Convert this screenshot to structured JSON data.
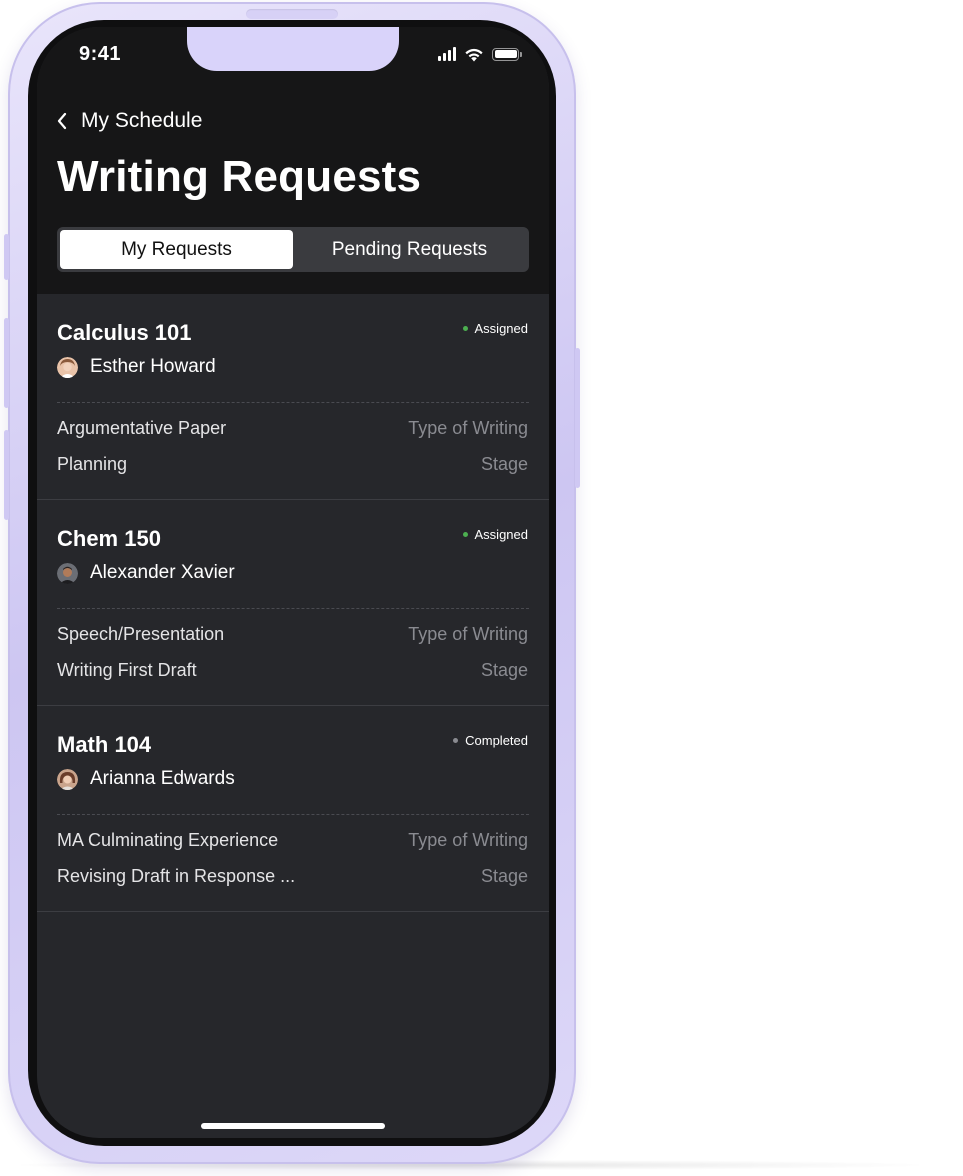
{
  "status_bar": {
    "time": "9:41"
  },
  "header": {
    "back_label": "My Schedule",
    "title": "Writing Requests"
  },
  "tabs": [
    {
      "label": "My Requests",
      "active": true
    },
    {
      "label": "Pending Requests",
      "active": false
    }
  ],
  "requests": [
    {
      "course": "Calculus 101",
      "status": "Assigned",
      "status_color": "#4caf50",
      "person": "Esther Howard",
      "type_value": "Argumentative Paper",
      "type_label": "Type of Writing",
      "stage_value": "Planning",
      "stage_label": "Stage"
    },
    {
      "course": "Chem 150",
      "status": "Assigned",
      "status_color": "#4caf50",
      "person": "Alexander Xavier",
      "type_value": "Speech/Presentation",
      "type_label": "Type of Writing",
      "stage_value": "Writing First Draft",
      "stage_label": "Stage"
    },
    {
      "course": "Math 104",
      "status": "Completed",
      "status_color": "#8a8b91",
      "person": "Arianna Edwards",
      "type_value": "MA Culminating Experience",
      "type_label": "Type of Writing",
      "stage_value": "Revising Draft in Response ...",
      "stage_label": "Stage"
    }
  ],
  "colors": {
    "header_bg": "#161617",
    "screen_bg": "#26272b",
    "phone_frame": "#d9d3fa"
  }
}
